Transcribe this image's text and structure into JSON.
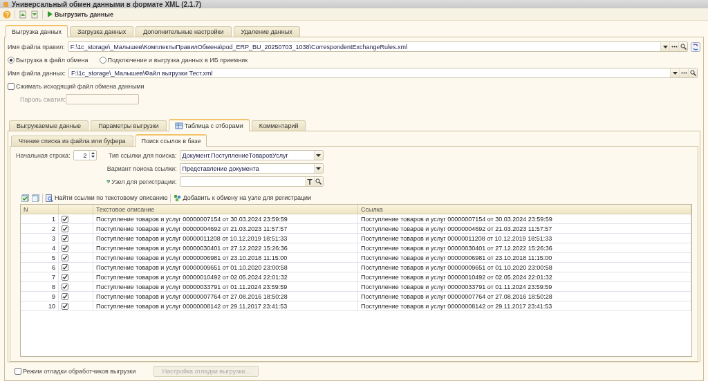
{
  "window": {
    "title": "Универсальный обмен данными в формате XML (2.1.7)"
  },
  "toolbar": {
    "run_label": "Выгрузить данные"
  },
  "main_tabs": [
    {
      "label": "Выгрузка данных",
      "selected": true
    },
    {
      "label": "Загрузка данных",
      "selected": false
    },
    {
      "label": "Дополнительные настройки",
      "selected": false
    },
    {
      "label": "Удаление данных",
      "selected": false
    }
  ],
  "rules_file": {
    "label": "Имя файла правил:",
    "value": "F:\\1c_storage\\_Малышев\\КомплектыПравилОбмена\\pod_ERP_BU_20250703_1038\\CorrespondentExchangeRules.xml"
  },
  "mode_options": [
    {
      "label": "Выгрузка в файл обмена",
      "selected": true
    },
    {
      "label": "Подключение и выгрузка данных в ИБ приемник",
      "selected": false
    }
  ],
  "data_file": {
    "label": "Имя файла данных:",
    "value": "F:\\1c_storage\\_Малышев\\Файл выгрузки Тест.xml"
  },
  "compress": {
    "label": "Сжимать исходящий файл обмена данными",
    "checked": false
  },
  "password": {
    "label": "Пароль сжатия:",
    "disabled": true
  },
  "inner_tabs": [
    {
      "label": "Выгружаемые данные",
      "selected": false,
      "kind": "plain"
    },
    {
      "label": "Параметры выгрузки",
      "selected": false,
      "kind": "plain"
    },
    {
      "label": "Таблица с отборами",
      "selected": true,
      "kind": "table"
    },
    {
      "label": "Комментарий",
      "selected": false,
      "kind": "plain"
    }
  ],
  "sub_tabs": [
    {
      "label": "Чтение списка из файла или буфера",
      "selected": false
    },
    {
      "label": "Поиск ссылок в базе",
      "selected": true
    }
  ],
  "start_row": {
    "label": "Начальная строка:",
    "value": "2"
  },
  "link_type": {
    "label": "Тип ссылки для поиска:",
    "value": "Документ.ПоступлениеТоваровУслуг"
  },
  "search_variant": {
    "label": "Вариант поиска ссылки:",
    "value": "Представление документа"
  },
  "node": {
    "label": "Узел для регистрации:"
  },
  "table_toolbar": {
    "find_label": "Найти ссылки по текстовому описанию",
    "add_label": "Добавить к обмену на узле для регистрации"
  },
  "table": {
    "columns": [
      "N",
      "Текстовое описание",
      "Ссылка"
    ],
    "rows": [
      {
        "n": "1",
        "checked": true,
        "description": "Поступление товаров и услуг 00000007154 от 30.03.2024 23:59:59",
        "link": "Поступление товаров и услуг 00000007154 от 30.03.2024 23:59:59"
      },
      {
        "n": "2",
        "checked": true,
        "description": "Поступление товаров и услуг 00000004692 от 21.03.2023 11:57:57",
        "link": "Поступление товаров и услуг 00000004692 от 21.03.2023 11:57:57"
      },
      {
        "n": "3",
        "checked": true,
        "description": "Поступление товаров и услуг 00000011208 от 10.12.2019 18:51:33",
        "link": "Поступление товаров и услуг 00000011208 от 10.12.2019 18:51:33"
      },
      {
        "n": "4",
        "checked": true,
        "description": "Поступление товаров и услуг 00000030401 от 27.12.2022 15:26:36",
        "link": "Поступление товаров и услуг 00000030401 от 27.12.2022 15:26:36"
      },
      {
        "n": "5",
        "checked": true,
        "description": "Поступление товаров и услуг 00000006981 от 23.10.2018 11:15:00",
        "link": "Поступление товаров и услуг 00000006981 от 23.10.2018 11:15:00"
      },
      {
        "n": "6",
        "checked": true,
        "description": "Поступление товаров и услуг 00000009651 от 01.10.2020 23:00:58",
        "link": "Поступление товаров и услуг 00000009651 от 01.10.2020 23:00:58"
      },
      {
        "n": "7",
        "checked": true,
        "description": "Поступление товаров и услуг 00000010492 от 02.05.2024 22:01:32",
        "link": "Поступление товаров и услуг 00000010492 от 02.05.2024 22:01:32"
      },
      {
        "n": "8",
        "checked": true,
        "description": "Поступление товаров и услуг 00000033791 от 01.11.2024 23:59:59",
        "link": "Поступление товаров и услуг 00000033791 от 01.11.2024 23:59:59"
      },
      {
        "n": "9",
        "checked": true,
        "description": "Поступление товаров и услуг 00000007764 от 27.08.2016 18:50:28",
        "link": "Поступление товаров и услуг 00000007764 от 27.08.2016 18:50:28"
      },
      {
        "n": "10",
        "checked": true,
        "description": "Поступление товаров и услуг 00000008142 от 29.11.2017 23:41:53",
        "link": "Поступление товаров и услуг 00000008142 от 29.11.2017 23:41:53"
      }
    ]
  },
  "debug": {
    "label": "Режим отладки обработчиков выгрузки",
    "checked": false
  },
  "debug_button": {
    "label": "Настройка отладки выгрузки...",
    "disabled": true
  }
}
